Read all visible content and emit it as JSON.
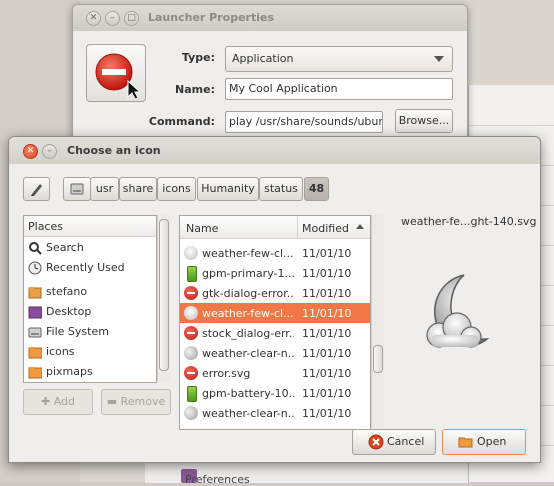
{
  "launcher": {
    "title": "Launcher Properties",
    "type_label": "Type:",
    "type_value": "Application",
    "name_label": "Name:",
    "name_value": "My Cool Application",
    "command_label": "Command:",
    "command_value": "play /usr/share/sounds/ubuntu",
    "browse_label": "Browse..."
  },
  "dialog": {
    "title": "Choose an icon",
    "path_buttons": [
      "usr",
      "share",
      "icons",
      "Humanity",
      "status",
      "48"
    ],
    "places_header": "Places",
    "places": [
      {
        "label": "Search",
        "icon": "search-icon"
      },
      {
        "label": "Recently Used",
        "icon": "clock-icon"
      },
      {
        "label": "stefano",
        "icon": "home-folder-icon"
      },
      {
        "label": "Desktop",
        "icon": "desktop-icon"
      },
      {
        "label": "File System",
        "icon": "drive-icon"
      },
      {
        "label": "icons",
        "icon": "folder-icon"
      },
      {
        "label": "pixmaps",
        "icon": "folder-icon"
      }
    ],
    "add_label": "Add",
    "remove_label": "Remove",
    "columns": {
      "name": "Name",
      "modified": "Modified"
    },
    "files": [
      {
        "name": "weather-few-cl...",
        "date": "11/01/10",
        "icon": "weather-cloud-icon"
      },
      {
        "name": "gpm-primary-1...",
        "date": "11/01/10",
        "icon": "battery-icon"
      },
      {
        "name": "gtk-dialog-error...",
        "date": "11/01/10",
        "icon": "error-icon"
      },
      {
        "name": "weather-few-cl...",
        "date": "11/01/10",
        "icon": "weather-cloud-icon",
        "selected": true
      },
      {
        "name": "stock_dialog-err...",
        "date": "11/01/10",
        "icon": "error-icon"
      },
      {
        "name": "weather-clear-n...",
        "date": "11/01/10",
        "icon": "weather-moon-icon"
      },
      {
        "name": "error.svg",
        "date": "11/01/10",
        "icon": "error-icon"
      },
      {
        "name": "gpm-battery-10...",
        "date": "11/01/10",
        "icon": "battery-icon"
      },
      {
        "name": "weather-clear-n...",
        "date": "11/01/10",
        "icon": "weather-moon-icon"
      }
    ],
    "preview_filename": "weather-fe...ght-140.svg",
    "cancel_label": "Cancel",
    "open_label": "Open"
  },
  "background": {
    "preferences_label": "Preferences"
  },
  "colors": {
    "accent": "#f07746",
    "error_red": "#d9441e"
  }
}
